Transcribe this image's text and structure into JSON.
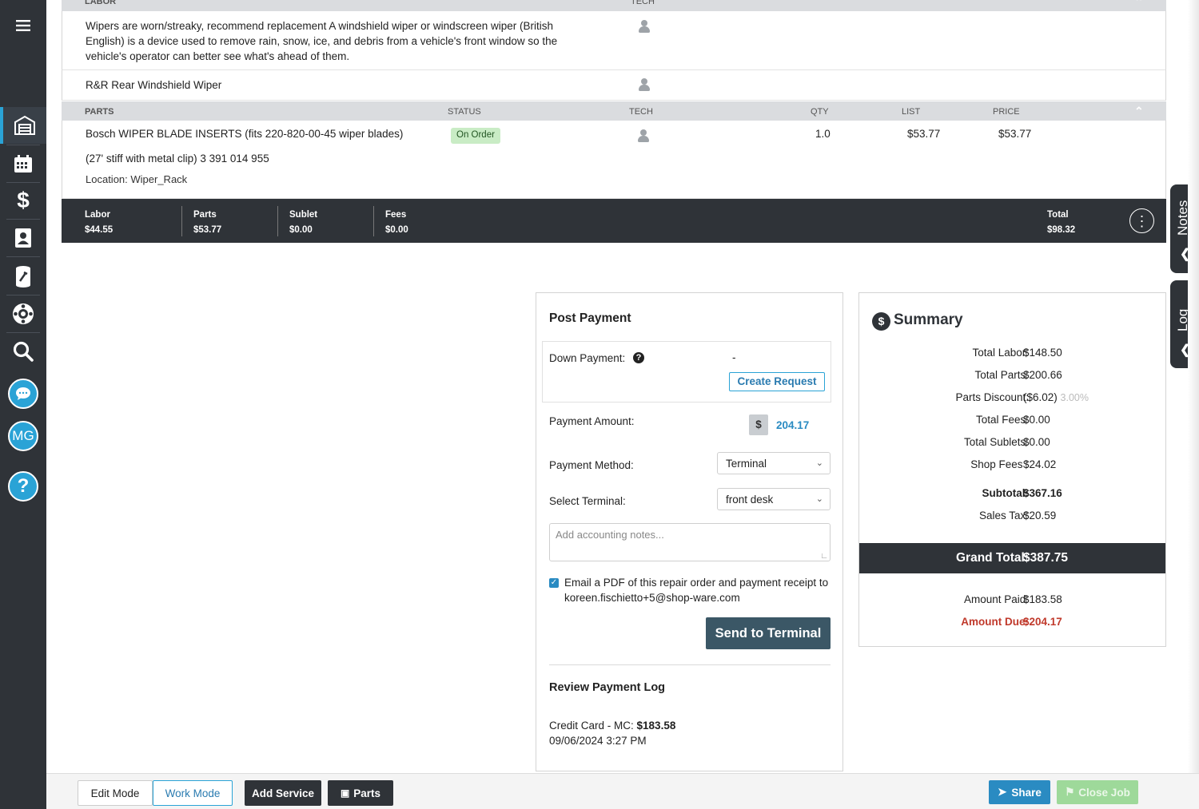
{
  "labor_section": {
    "header": "LABOR",
    "tech_header": "TECH",
    "rows": [
      {
        "description": "Wipers are worn/streaky, recommend replacement A windshield wiper or windscreen wiper (British English) is a device used to remove rain, snow, ice, and debris from a vehicle's front window so the vehicle's operator can better see what's ahead of them."
      },
      {
        "description": "R&R Rear Windshield Wiper"
      }
    ]
  },
  "parts_section": {
    "header": "PARTS",
    "columns": {
      "status": "STATUS",
      "tech": "TECH",
      "qty": "QTY",
      "list": "LIST",
      "price": "PRICE"
    },
    "rows": [
      {
        "name": "Bosch WIPER BLADE INSERTS (fits 220-820-00-45 wiper blades)",
        "name2": "(27' stiff with metal clip) 3 391 014 955",
        "location": "Location: Wiper_Rack",
        "status": "On Order",
        "qty": "1.0",
        "list": "$53.77",
        "price": "$53.77"
      }
    ]
  },
  "job_totals": {
    "labor_label": "Labor",
    "labor_value": "$44.55",
    "parts_label": "Parts",
    "parts_value": "$53.77",
    "sublet_label": "Sublet",
    "sublet_value": "$0.00",
    "fees_label": "Fees",
    "fees_value": "$0.00",
    "total_label": "Total",
    "total_value": "$98.32"
  },
  "post_payment": {
    "title": "Post Payment",
    "down_payment_label": "Down Payment:",
    "down_payment_value": "-",
    "create_request": "Create Request",
    "payment_amount_label": "Payment Amount:",
    "currency_symbol": "$",
    "payment_amount_value": "204.17",
    "payment_method_label": "Payment Method:",
    "payment_method_value": "Terminal",
    "terminal_label": "Select Terminal:",
    "terminal_value": "front desk",
    "notes_placeholder": "Add accounting notes...",
    "email_checked": true,
    "email_text": "Email a PDF of this repair order and payment receipt to koreen.fischietto+5@shop-ware.com",
    "send_button": "Send to Terminal",
    "log_title": "Review Payment Log",
    "log_entry_method": "Credit Card - MC:",
    "log_entry_amount": "$183.58",
    "log_entry_date": "09/06/2024 3:27 PM"
  },
  "summary": {
    "title": "Summary",
    "rows": [
      {
        "label": "Total Labor:",
        "value": "$148.50"
      },
      {
        "label": "Total Parts:",
        "value": "$200.66"
      },
      {
        "label": "Parts Discount:",
        "value": "($6.02)",
        "extra": "3.00%"
      },
      {
        "label": "Total Fees:",
        "value": "$0.00"
      },
      {
        "label": "Total Sublets:",
        "value": "$0.00"
      },
      {
        "label": "Shop Fees :",
        "value": "$24.02"
      }
    ],
    "subtotal_label": "Subtotal:",
    "subtotal_value": "$367.16",
    "tax_label": "Sales Tax:",
    "tax_value": "$20.59",
    "grand_total_label": "Grand Total:",
    "grand_total_value": "$387.75",
    "amount_paid_label": "Amount Paid:",
    "amount_paid_value": "$183.58",
    "amount_due_label": "Amount Due:",
    "amount_due_value": "$204.17"
  },
  "side_tabs": {
    "notes": "Notes",
    "log": "Log"
  },
  "sidebar": {
    "avatar_initials": "MG"
  },
  "bottom_bar": {
    "edit_mode": "Edit Mode",
    "work_mode": "Work Mode",
    "add_service": "Add Service",
    "parts": "Parts",
    "share": "Share",
    "close_job": "Close Job"
  },
  "colors": {
    "accent": "#2aa3d6",
    "dark": "#2f3338",
    "due": "#c0392b",
    "status_badge": "#c9ecc5",
    "close_job": "#9ed99a"
  }
}
